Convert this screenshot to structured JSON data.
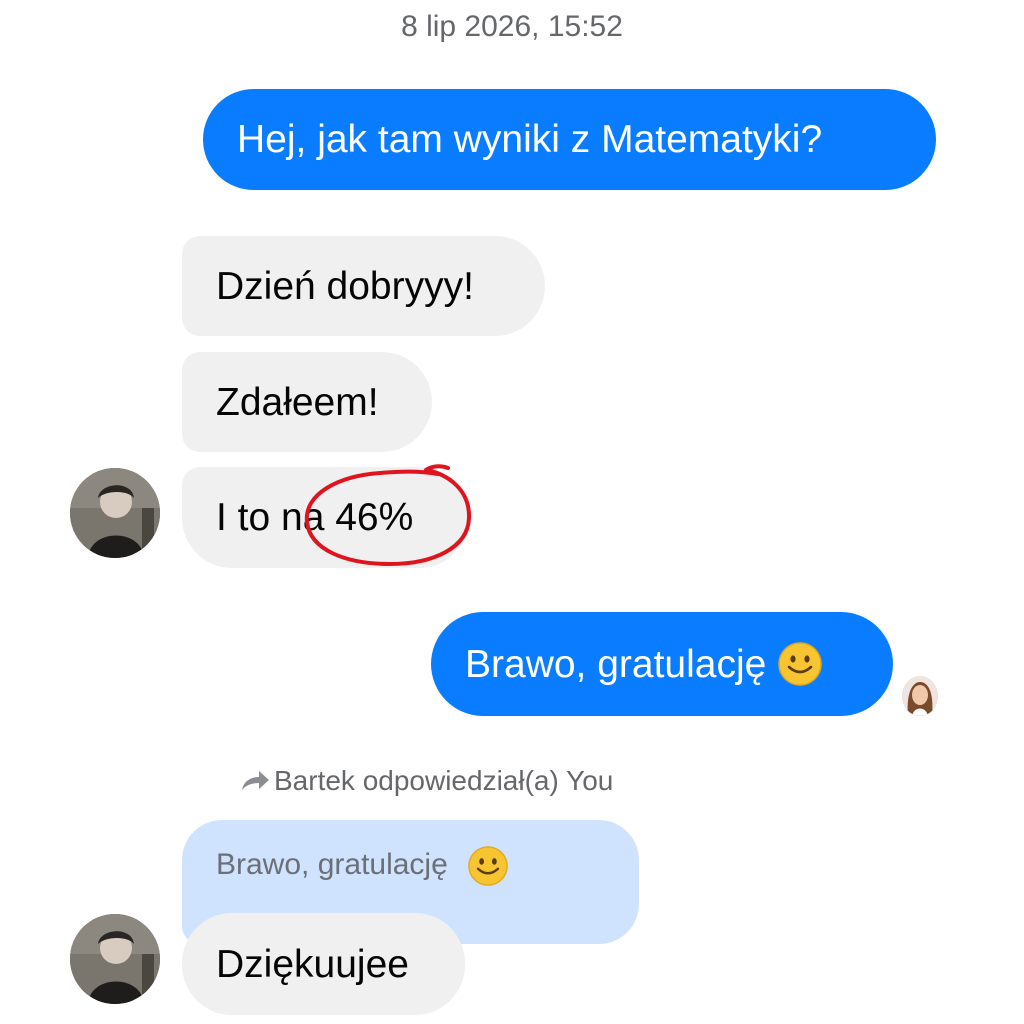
{
  "timestamp": "8 lip 2026, 15:52",
  "messages": [
    {
      "text": "Hej, jak tam wyniki z Matematyki?"
    },
    {
      "text": "Dzień dobryyy!"
    },
    {
      "text": "Zdałeem!"
    },
    {
      "text": "I to na 46%"
    },
    {
      "text": "Brawo, gratulację",
      "emoji": "smiling-face-emoji"
    },
    {
      "text": "Dziękuujee"
    }
  ],
  "reply": {
    "label": "Bartek odpowiedział(a) You",
    "quoted_text": "Brawo, gratulację",
    "quoted_emoji": "smiling-face-emoji",
    "icon": "reply-arrow-icon"
  },
  "colors": {
    "outgoing": "#0a7cff",
    "incoming": "#f0f0f0",
    "quoted": "#cfe3ff",
    "annotation": "#e0141e"
  }
}
